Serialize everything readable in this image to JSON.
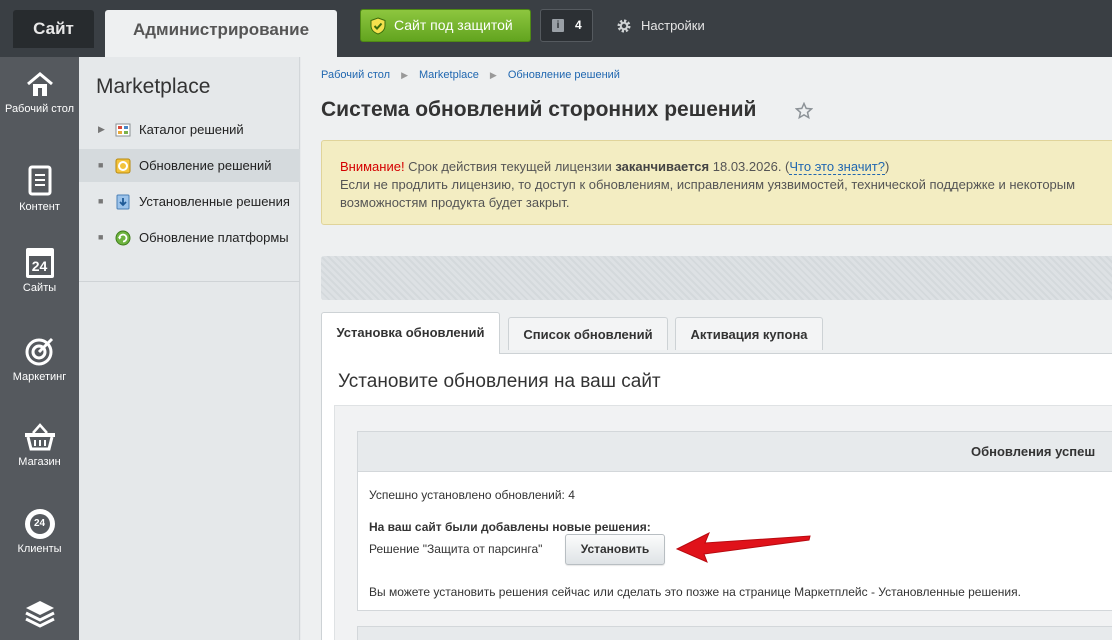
{
  "topbar": {
    "site_tab": "Сайт",
    "admin_tab": "Администрирование",
    "protect_button": "Сайт под защитой",
    "notifications_count": "4",
    "settings_label": "Настройки"
  },
  "leftbar": {
    "items": [
      {
        "label": "Рабочий стол",
        "icon": "home-icon"
      },
      {
        "label": "Контент",
        "icon": "document-icon"
      },
      {
        "label": "Сайты",
        "icon": "calendar-24-icon"
      },
      {
        "label": "Маркетинг",
        "icon": "target-icon"
      },
      {
        "label": "Магазин",
        "icon": "basket-icon"
      },
      {
        "label": "Клиенты",
        "icon": "clients-24-icon"
      },
      {
        "label": "",
        "icon": "layers-icon"
      }
    ],
    "calendar_number": "24",
    "clients_number": "24"
  },
  "sidebar": {
    "title": "Marketplace",
    "items": [
      {
        "label": "Каталог решений",
        "icon": "catalog-icon"
      },
      {
        "label": "Обновление решений",
        "icon": "update-solutions-icon",
        "active": true
      },
      {
        "label": "Установленные решения",
        "icon": "installed-icon"
      },
      {
        "label": "Обновление платформы",
        "icon": "platform-update-icon"
      }
    ]
  },
  "breadcrumb": [
    "Рабочий стол",
    "Marketplace",
    "Обновление решений"
  ],
  "page": {
    "title": "Система обновлений сторонних решений"
  },
  "warning": {
    "attention": "Внимание!",
    "text1": " Срок действия текущей лицензии ",
    "expires": "заканчивается",
    "date": " 18.03.2026. (",
    "link": "Что это значит?",
    "close_paren": ")",
    "text2": "Если не продлить лицензию, то доступ к обновлениям, исправлениям уязвимостей, технической поддержке и некоторым возможностям продукта будет закрыт."
  },
  "tabs": [
    {
      "label": "Установка обновлений",
      "active": true
    },
    {
      "label": "Список обновлений"
    },
    {
      "label": "Активация купона"
    }
  ],
  "panel": {
    "title": "Установите обновления на ваш сайт",
    "box_header": "Обновления успеш",
    "installed_count_text": "Успешно установлено обновлений: 4",
    "new_solutions_heading": "На ваш сайт были добавлены новые решения:",
    "solution_text": "Решение \"Защита от парсинга\"",
    "install_button": "Установить",
    "footer_text": "Вы можете установить решения сейчас или сделать это позже на странице Маркетплейс - Установленные решения."
  },
  "colors": {
    "accent_green": "#62a41f",
    "link_blue": "#2067b0",
    "warning_red": "#d40000",
    "arrow_red": "#e0121a"
  }
}
